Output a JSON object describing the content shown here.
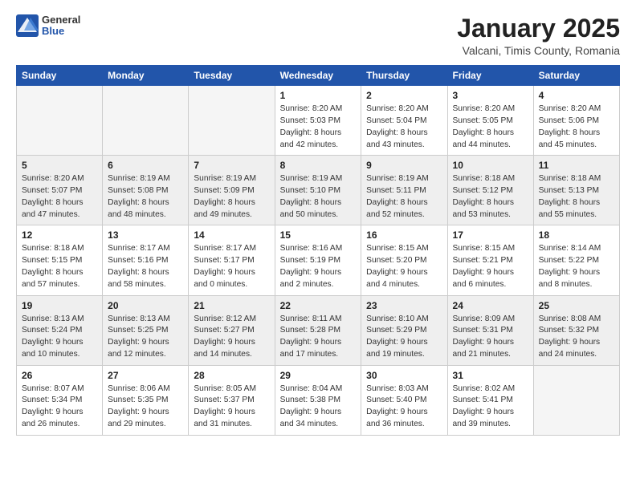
{
  "logo": {
    "general": "General",
    "blue": "Blue"
  },
  "title": "January 2025",
  "subtitle": "Valcani, Timis County, Romania",
  "weekdays": [
    "Sunday",
    "Monday",
    "Tuesday",
    "Wednesday",
    "Thursday",
    "Friday",
    "Saturday"
  ],
  "weeks": [
    [
      {
        "day": "",
        "info": ""
      },
      {
        "day": "",
        "info": ""
      },
      {
        "day": "",
        "info": ""
      },
      {
        "day": "1",
        "info": "Sunrise: 8:20 AM\nSunset: 5:03 PM\nDaylight: 8 hours\nand 42 minutes."
      },
      {
        "day": "2",
        "info": "Sunrise: 8:20 AM\nSunset: 5:04 PM\nDaylight: 8 hours\nand 43 minutes."
      },
      {
        "day": "3",
        "info": "Sunrise: 8:20 AM\nSunset: 5:05 PM\nDaylight: 8 hours\nand 44 minutes."
      },
      {
        "day": "4",
        "info": "Sunrise: 8:20 AM\nSunset: 5:06 PM\nDaylight: 8 hours\nand 45 minutes."
      }
    ],
    [
      {
        "day": "5",
        "info": "Sunrise: 8:20 AM\nSunset: 5:07 PM\nDaylight: 8 hours\nand 47 minutes."
      },
      {
        "day": "6",
        "info": "Sunrise: 8:19 AM\nSunset: 5:08 PM\nDaylight: 8 hours\nand 48 minutes."
      },
      {
        "day": "7",
        "info": "Sunrise: 8:19 AM\nSunset: 5:09 PM\nDaylight: 8 hours\nand 49 minutes."
      },
      {
        "day": "8",
        "info": "Sunrise: 8:19 AM\nSunset: 5:10 PM\nDaylight: 8 hours\nand 50 minutes."
      },
      {
        "day": "9",
        "info": "Sunrise: 8:19 AM\nSunset: 5:11 PM\nDaylight: 8 hours\nand 52 minutes."
      },
      {
        "day": "10",
        "info": "Sunrise: 8:18 AM\nSunset: 5:12 PM\nDaylight: 8 hours\nand 53 minutes."
      },
      {
        "day": "11",
        "info": "Sunrise: 8:18 AM\nSunset: 5:13 PM\nDaylight: 8 hours\nand 55 minutes."
      }
    ],
    [
      {
        "day": "12",
        "info": "Sunrise: 8:18 AM\nSunset: 5:15 PM\nDaylight: 8 hours\nand 57 minutes."
      },
      {
        "day": "13",
        "info": "Sunrise: 8:17 AM\nSunset: 5:16 PM\nDaylight: 8 hours\nand 58 minutes."
      },
      {
        "day": "14",
        "info": "Sunrise: 8:17 AM\nSunset: 5:17 PM\nDaylight: 9 hours\nand 0 minutes."
      },
      {
        "day": "15",
        "info": "Sunrise: 8:16 AM\nSunset: 5:19 PM\nDaylight: 9 hours\nand 2 minutes."
      },
      {
        "day": "16",
        "info": "Sunrise: 8:15 AM\nSunset: 5:20 PM\nDaylight: 9 hours\nand 4 minutes."
      },
      {
        "day": "17",
        "info": "Sunrise: 8:15 AM\nSunset: 5:21 PM\nDaylight: 9 hours\nand 6 minutes."
      },
      {
        "day": "18",
        "info": "Sunrise: 8:14 AM\nSunset: 5:22 PM\nDaylight: 9 hours\nand 8 minutes."
      }
    ],
    [
      {
        "day": "19",
        "info": "Sunrise: 8:13 AM\nSunset: 5:24 PM\nDaylight: 9 hours\nand 10 minutes."
      },
      {
        "day": "20",
        "info": "Sunrise: 8:13 AM\nSunset: 5:25 PM\nDaylight: 9 hours\nand 12 minutes."
      },
      {
        "day": "21",
        "info": "Sunrise: 8:12 AM\nSunset: 5:27 PM\nDaylight: 9 hours\nand 14 minutes."
      },
      {
        "day": "22",
        "info": "Sunrise: 8:11 AM\nSunset: 5:28 PM\nDaylight: 9 hours\nand 17 minutes."
      },
      {
        "day": "23",
        "info": "Sunrise: 8:10 AM\nSunset: 5:29 PM\nDaylight: 9 hours\nand 19 minutes."
      },
      {
        "day": "24",
        "info": "Sunrise: 8:09 AM\nSunset: 5:31 PM\nDaylight: 9 hours\nand 21 minutes."
      },
      {
        "day": "25",
        "info": "Sunrise: 8:08 AM\nSunset: 5:32 PM\nDaylight: 9 hours\nand 24 minutes."
      }
    ],
    [
      {
        "day": "26",
        "info": "Sunrise: 8:07 AM\nSunset: 5:34 PM\nDaylight: 9 hours\nand 26 minutes."
      },
      {
        "day": "27",
        "info": "Sunrise: 8:06 AM\nSunset: 5:35 PM\nDaylight: 9 hours\nand 29 minutes."
      },
      {
        "day": "28",
        "info": "Sunrise: 8:05 AM\nSunset: 5:37 PM\nDaylight: 9 hours\nand 31 minutes."
      },
      {
        "day": "29",
        "info": "Sunrise: 8:04 AM\nSunset: 5:38 PM\nDaylight: 9 hours\nand 34 minutes."
      },
      {
        "day": "30",
        "info": "Sunrise: 8:03 AM\nSunset: 5:40 PM\nDaylight: 9 hours\nand 36 minutes."
      },
      {
        "day": "31",
        "info": "Sunrise: 8:02 AM\nSunset: 5:41 PM\nDaylight: 9 hours\nand 39 minutes."
      },
      {
        "day": "",
        "info": ""
      }
    ]
  ]
}
